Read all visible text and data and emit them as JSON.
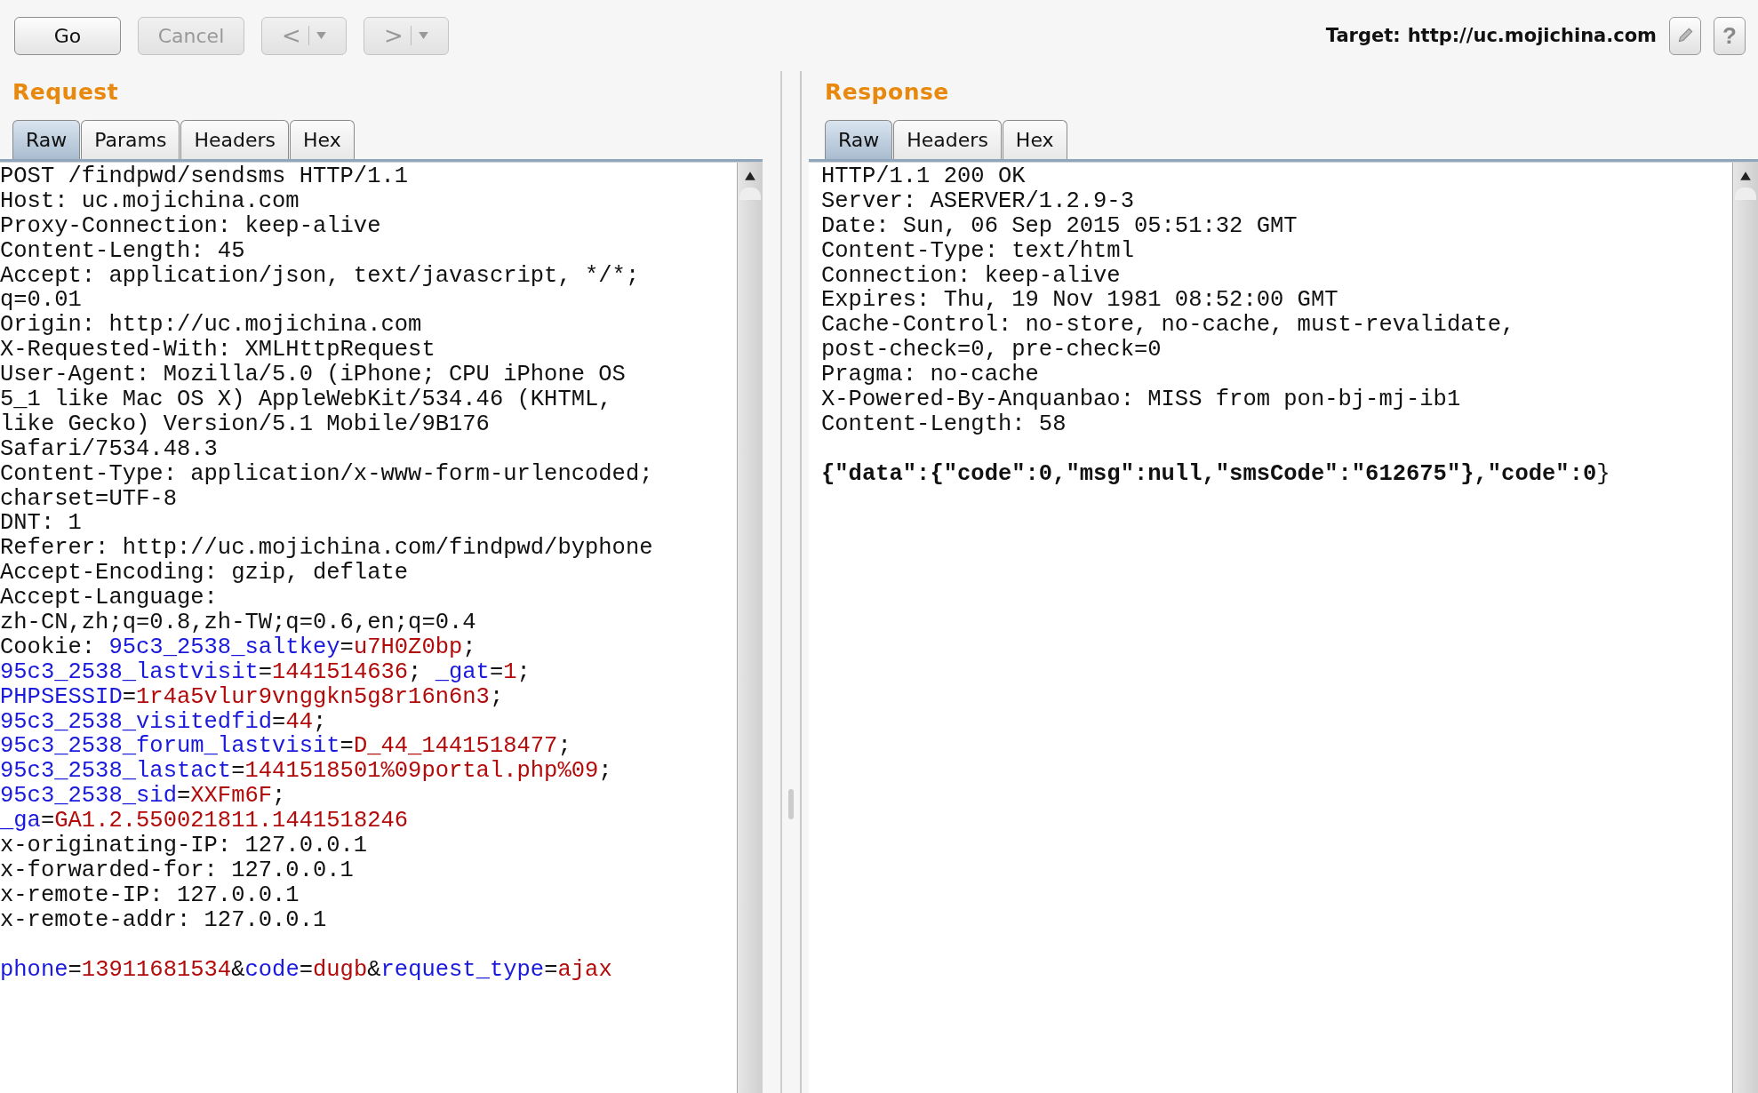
{
  "toolbar": {
    "buttons": [
      {
        "label": "Go",
        "kind": "text",
        "disabled": false
      },
      {
        "label": "Cancel",
        "kind": "text",
        "disabled": true
      },
      {
        "label": "<",
        "kind": "menu",
        "disabled": true
      },
      {
        "label": ">",
        "kind": "menu",
        "disabled": true
      }
    ],
    "target_label": "Target:",
    "target": "http://uc.mojichina.com",
    "help": "?"
  },
  "request": {
    "title": "Request",
    "tabs": [
      {
        "label": "Raw",
        "selected": true
      },
      {
        "label": "Params",
        "selected": false
      },
      {
        "label": "Headers",
        "selected": false
      },
      {
        "label": "Hex",
        "selected": false
      }
    ],
    "lines": [
      {
        "kind": "text",
        "segments": [
          {
            "kind": "plain",
            "text": "POST /findpwd/sendsms HTTP/1.1"
          }
        ]
      },
      {
        "kind": "text",
        "segments": [
          {
            "kind": "plain",
            "text": "Host: uc.mojichina.com"
          }
        ]
      },
      {
        "kind": "text",
        "segments": [
          {
            "kind": "plain",
            "text": "Proxy-Connection: keep-alive"
          }
        ]
      },
      {
        "kind": "text",
        "segments": [
          {
            "kind": "plain",
            "text": "Content-Length: 45"
          }
        ]
      },
      {
        "kind": "text",
        "segments": [
          {
            "kind": "plain",
            "text": "Accept: application/json, text/javascript, */*;"
          }
        ]
      },
      {
        "kind": "text",
        "segments": [
          {
            "kind": "plain",
            "text": "q=0.01"
          }
        ]
      },
      {
        "kind": "text",
        "segments": [
          {
            "kind": "plain",
            "text": "Origin: http://uc.mojichina.com"
          }
        ]
      },
      {
        "kind": "text",
        "segments": [
          {
            "kind": "plain",
            "text": "X-Requested-With: XMLHttpRequest"
          }
        ]
      },
      {
        "kind": "text",
        "segments": [
          {
            "kind": "plain",
            "text": "User-Agent: Mozilla/5.0 (iPhone; CPU iPhone OS"
          }
        ]
      },
      {
        "kind": "text",
        "segments": [
          {
            "kind": "plain",
            "text": "5_1 like Mac OS X) AppleWebKit/534.46 (KHTML,"
          }
        ]
      },
      {
        "kind": "text",
        "segments": [
          {
            "kind": "plain",
            "text": "like Gecko) Version/5.1 Mobile/9B176"
          }
        ]
      },
      {
        "kind": "text",
        "segments": [
          {
            "kind": "plain",
            "text": "Safari/7534.48.3"
          }
        ]
      },
      {
        "kind": "text",
        "segments": [
          {
            "kind": "plain",
            "text": "Content-Type: application/x-www-form-urlencoded;"
          }
        ]
      },
      {
        "kind": "text",
        "segments": [
          {
            "kind": "plain",
            "text": "charset=UTF-8"
          }
        ]
      },
      {
        "kind": "text",
        "segments": [
          {
            "kind": "plain",
            "text": "DNT: 1"
          }
        ]
      },
      {
        "kind": "text",
        "segments": [
          {
            "kind": "plain",
            "text": "Referer: http://uc.mojichina.com/findpwd/byphone"
          }
        ]
      },
      {
        "kind": "text",
        "segments": [
          {
            "kind": "plain",
            "text": "Accept-Encoding: gzip, deflate"
          }
        ]
      },
      {
        "kind": "text",
        "segments": [
          {
            "kind": "plain",
            "text": "Accept-Language:"
          }
        ]
      },
      {
        "kind": "text",
        "segments": [
          {
            "kind": "plain",
            "text": "zh-CN,zh;q=0.8,zh-TW;q=0.6,en;q=0.4"
          }
        ]
      },
      {
        "kind": "text",
        "segments": [
          {
            "kind": "plain",
            "text": "Cookie: "
          },
          {
            "kind": "name",
            "text": "95c3_2538_saltkey"
          },
          {
            "kind": "plain",
            "text": "="
          },
          {
            "kind": "value",
            "text": "u7H0Z0bp"
          },
          {
            "kind": "plain",
            "text": ";"
          }
        ]
      },
      {
        "kind": "text",
        "segments": [
          {
            "kind": "name",
            "text": "95c3_2538_lastvisit"
          },
          {
            "kind": "plain",
            "text": "="
          },
          {
            "kind": "value",
            "text": "1441514636"
          },
          {
            "kind": "plain",
            "text": "; "
          },
          {
            "kind": "name",
            "text": "_gat"
          },
          {
            "kind": "plain",
            "text": "="
          },
          {
            "kind": "value",
            "text": "1"
          },
          {
            "kind": "plain",
            "text": ";"
          }
        ]
      },
      {
        "kind": "text",
        "segments": [
          {
            "kind": "name",
            "text": "PHPSESSID"
          },
          {
            "kind": "plain",
            "text": "="
          },
          {
            "kind": "value",
            "text": "1r4a5vlur9vnggkn5g8r16n6n3"
          },
          {
            "kind": "plain",
            "text": ";"
          }
        ]
      },
      {
        "kind": "text",
        "segments": [
          {
            "kind": "name",
            "text": "95c3_2538_visitedfid"
          },
          {
            "kind": "plain",
            "text": "="
          },
          {
            "kind": "value",
            "text": "44"
          },
          {
            "kind": "plain",
            "text": ";"
          }
        ]
      },
      {
        "kind": "text",
        "segments": [
          {
            "kind": "name",
            "text": "95c3_2538_forum_lastvisit"
          },
          {
            "kind": "plain",
            "text": "="
          },
          {
            "kind": "value",
            "text": "D_44_1441518477"
          },
          {
            "kind": "plain",
            "text": ";"
          }
        ]
      },
      {
        "kind": "text",
        "segments": [
          {
            "kind": "name",
            "text": "95c3_2538_lastact"
          },
          {
            "kind": "plain",
            "text": "="
          },
          {
            "kind": "value",
            "text": "1441518501%09portal.php%09"
          },
          {
            "kind": "plain",
            "text": ";"
          }
        ]
      },
      {
        "kind": "text",
        "segments": [
          {
            "kind": "name",
            "text": "95c3_2538_sid"
          },
          {
            "kind": "plain",
            "text": "="
          },
          {
            "kind": "value",
            "text": "XXFm6F"
          },
          {
            "kind": "plain",
            "text": ";"
          }
        ]
      },
      {
        "kind": "text",
        "segments": [
          {
            "kind": "name",
            "text": "_ga"
          },
          {
            "kind": "plain",
            "text": "="
          },
          {
            "kind": "value",
            "text": "GA1.2.550021811.1441518246"
          }
        ]
      },
      {
        "kind": "text",
        "segments": [
          {
            "kind": "plain",
            "text": "x-originating-IP: 127.0.0.1"
          }
        ]
      },
      {
        "kind": "text",
        "segments": [
          {
            "kind": "plain",
            "text": "x-forwarded-for: 127.0.0.1"
          }
        ]
      },
      {
        "kind": "text",
        "segments": [
          {
            "kind": "plain",
            "text": "x-remote-IP: 127.0.0.1"
          }
        ]
      },
      {
        "kind": "text",
        "segments": [
          {
            "kind": "plain",
            "text": "x-remote-addr: 127.0.0.1"
          }
        ]
      },
      {
        "kind": "blank"
      },
      {
        "kind": "text",
        "segments": [
          {
            "kind": "name",
            "text": "phone"
          },
          {
            "kind": "plain",
            "text": "="
          },
          {
            "kind": "value",
            "text": "13911681534"
          },
          {
            "kind": "plain",
            "text": "&"
          },
          {
            "kind": "name",
            "text": "code"
          },
          {
            "kind": "plain",
            "text": "="
          },
          {
            "kind": "value",
            "text": "dugb"
          },
          {
            "kind": "plain",
            "text": "&"
          },
          {
            "kind": "name",
            "text": "request_type"
          },
          {
            "kind": "plain",
            "text": "="
          },
          {
            "kind": "value",
            "text": "ajax"
          }
        ]
      }
    ]
  },
  "response": {
    "title": "Response",
    "tabs": [
      {
        "label": "Raw",
        "selected": true
      },
      {
        "label": "Headers",
        "selected": false
      },
      {
        "label": "Hex",
        "selected": false
      }
    ],
    "lines": [
      {
        "kind": "text",
        "segments": [
          {
            "kind": "plain",
            "text": "HTTP/1.1 200 OK"
          }
        ]
      },
      {
        "kind": "text",
        "segments": [
          {
            "kind": "plain",
            "text": "Server: ASERVER/1.2.9-3"
          }
        ]
      },
      {
        "kind": "text",
        "segments": [
          {
            "kind": "plain",
            "text": "Date: Sun, 06 Sep 2015 05:51:32 GMT"
          }
        ]
      },
      {
        "kind": "text",
        "segments": [
          {
            "kind": "plain",
            "text": "Content-Type: text/html"
          }
        ]
      },
      {
        "kind": "text",
        "segments": [
          {
            "kind": "plain",
            "text": "Connection: keep-alive"
          }
        ]
      },
      {
        "kind": "text",
        "segments": [
          {
            "kind": "plain",
            "text": "Expires: Thu, 19 Nov 1981 08:52:00 GMT"
          }
        ]
      },
      {
        "kind": "text",
        "segments": [
          {
            "kind": "plain",
            "text": "Cache-Control: no-store, no-cache, must-revalidate,"
          }
        ]
      },
      {
        "kind": "text",
        "segments": [
          {
            "kind": "plain",
            "text": "post-check=0, pre-check=0"
          }
        ]
      },
      {
        "kind": "text",
        "segments": [
          {
            "kind": "plain",
            "text": "Pragma: no-cache"
          }
        ]
      },
      {
        "kind": "text",
        "segments": [
          {
            "kind": "plain",
            "text": "X-Powered-By-Anquanbao: MISS from pon-bj-mj-ib1"
          }
        ]
      },
      {
        "kind": "text",
        "segments": [
          {
            "kind": "plain",
            "text": "Content-Length: 58"
          }
        ]
      },
      {
        "kind": "blank"
      },
      {
        "kind": "text",
        "segments": [
          {
            "kind": "bold",
            "text": "{\"data\":{\"code\":0,\"msg\":null,\"smsCode\":\"612675\"},\"code\":0"
          },
          {
            "kind": "plain",
            "text": "}"
          }
        ]
      }
    ]
  }
}
